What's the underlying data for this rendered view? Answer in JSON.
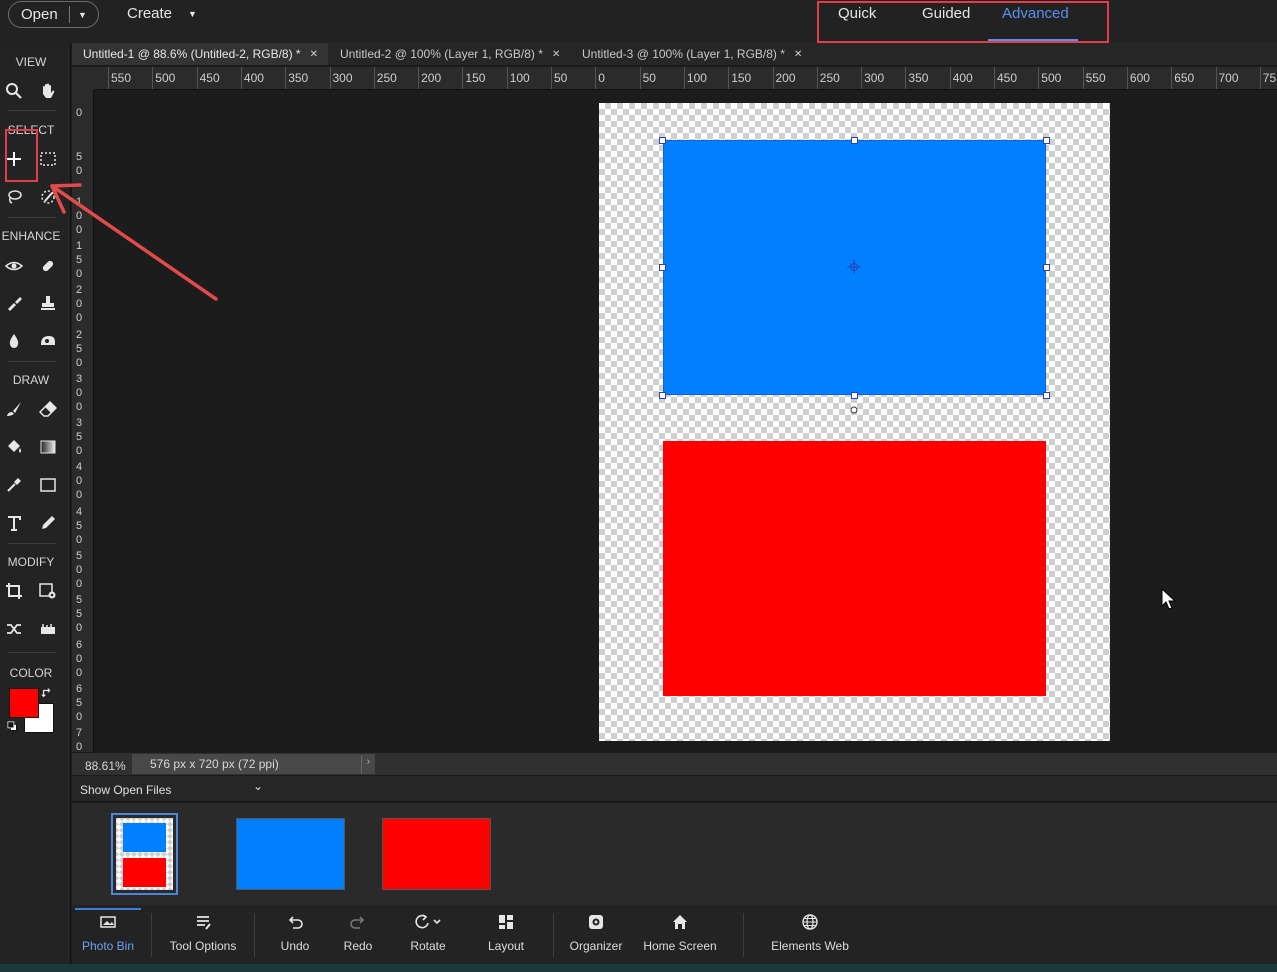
{
  "topbar": {
    "open_label": "Open",
    "create_label": "Create",
    "modes": [
      "Quick",
      "Guided",
      "Advanced"
    ],
    "active_mode": "Advanced"
  },
  "tabs": [
    {
      "label": "Untitled-1 @ 88.6% (Untitled-2, RGB/8) *"
    },
    {
      "label": "Untitled-2 @ 100% (Layer 1, RGB/8) *"
    },
    {
      "label": "Untitled-3 @ 100% (Layer 1, RGB/8) *"
    }
  ],
  "toolbar": {
    "sections": [
      "VIEW",
      "SELECT",
      "ENHANCE",
      "DRAW",
      "MODIFY",
      "COLOR"
    ],
    "foreground_color": "#ff0000",
    "background_color": "#ffffff"
  },
  "ruler_top": [
    "550",
    "500",
    "450",
    "400",
    "350",
    "300",
    "250",
    "200",
    "150",
    "100",
    "50",
    "0",
    "50",
    "100",
    "150",
    "200",
    "250",
    "300",
    "350",
    "400",
    "450",
    "500",
    "550",
    "600",
    "650",
    "700",
    "75"
  ],
  "ruler_left": [
    [
      "0"
    ],
    [
      "5",
      "0"
    ],
    [
      "1",
      "0",
      "0"
    ],
    [
      "1",
      "5",
      "0"
    ],
    [
      "2",
      "0",
      "0"
    ],
    [
      "2",
      "5",
      "0"
    ],
    [
      "3",
      "0",
      "0"
    ],
    [
      "3",
      "5",
      "0"
    ],
    [
      "4",
      "0",
      "0"
    ],
    [
      "4",
      "5",
      "0"
    ],
    [
      "5",
      "0",
      "0"
    ],
    [
      "5",
      "5",
      "0"
    ],
    [
      "6",
      "0",
      "0"
    ],
    [
      "6",
      "5",
      "0"
    ],
    [
      "7",
      "0"
    ]
  ],
  "status": {
    "zoom": "88.61%",
    "doc_size": "576 px x 720 px (72 ppi)"
  },
  "photo_bin": {
    "dropdown_label": "Show Open Files"
  },
  "bottombar": {
    "items": [
      "Photo Bin",
      "Tool Options",
      "Undo",
      "Redo",
      "Rotate",
      "Layout",
      "Organizer",
      "Home Screen",
      "Elements Web"
    ]
  },
  "colors": {
    "blue": "#0080ff",
    "red": "#ff0000",
    "accent": "#5a8ff0",
    "annotation": "#e23d4a"
  }
}
